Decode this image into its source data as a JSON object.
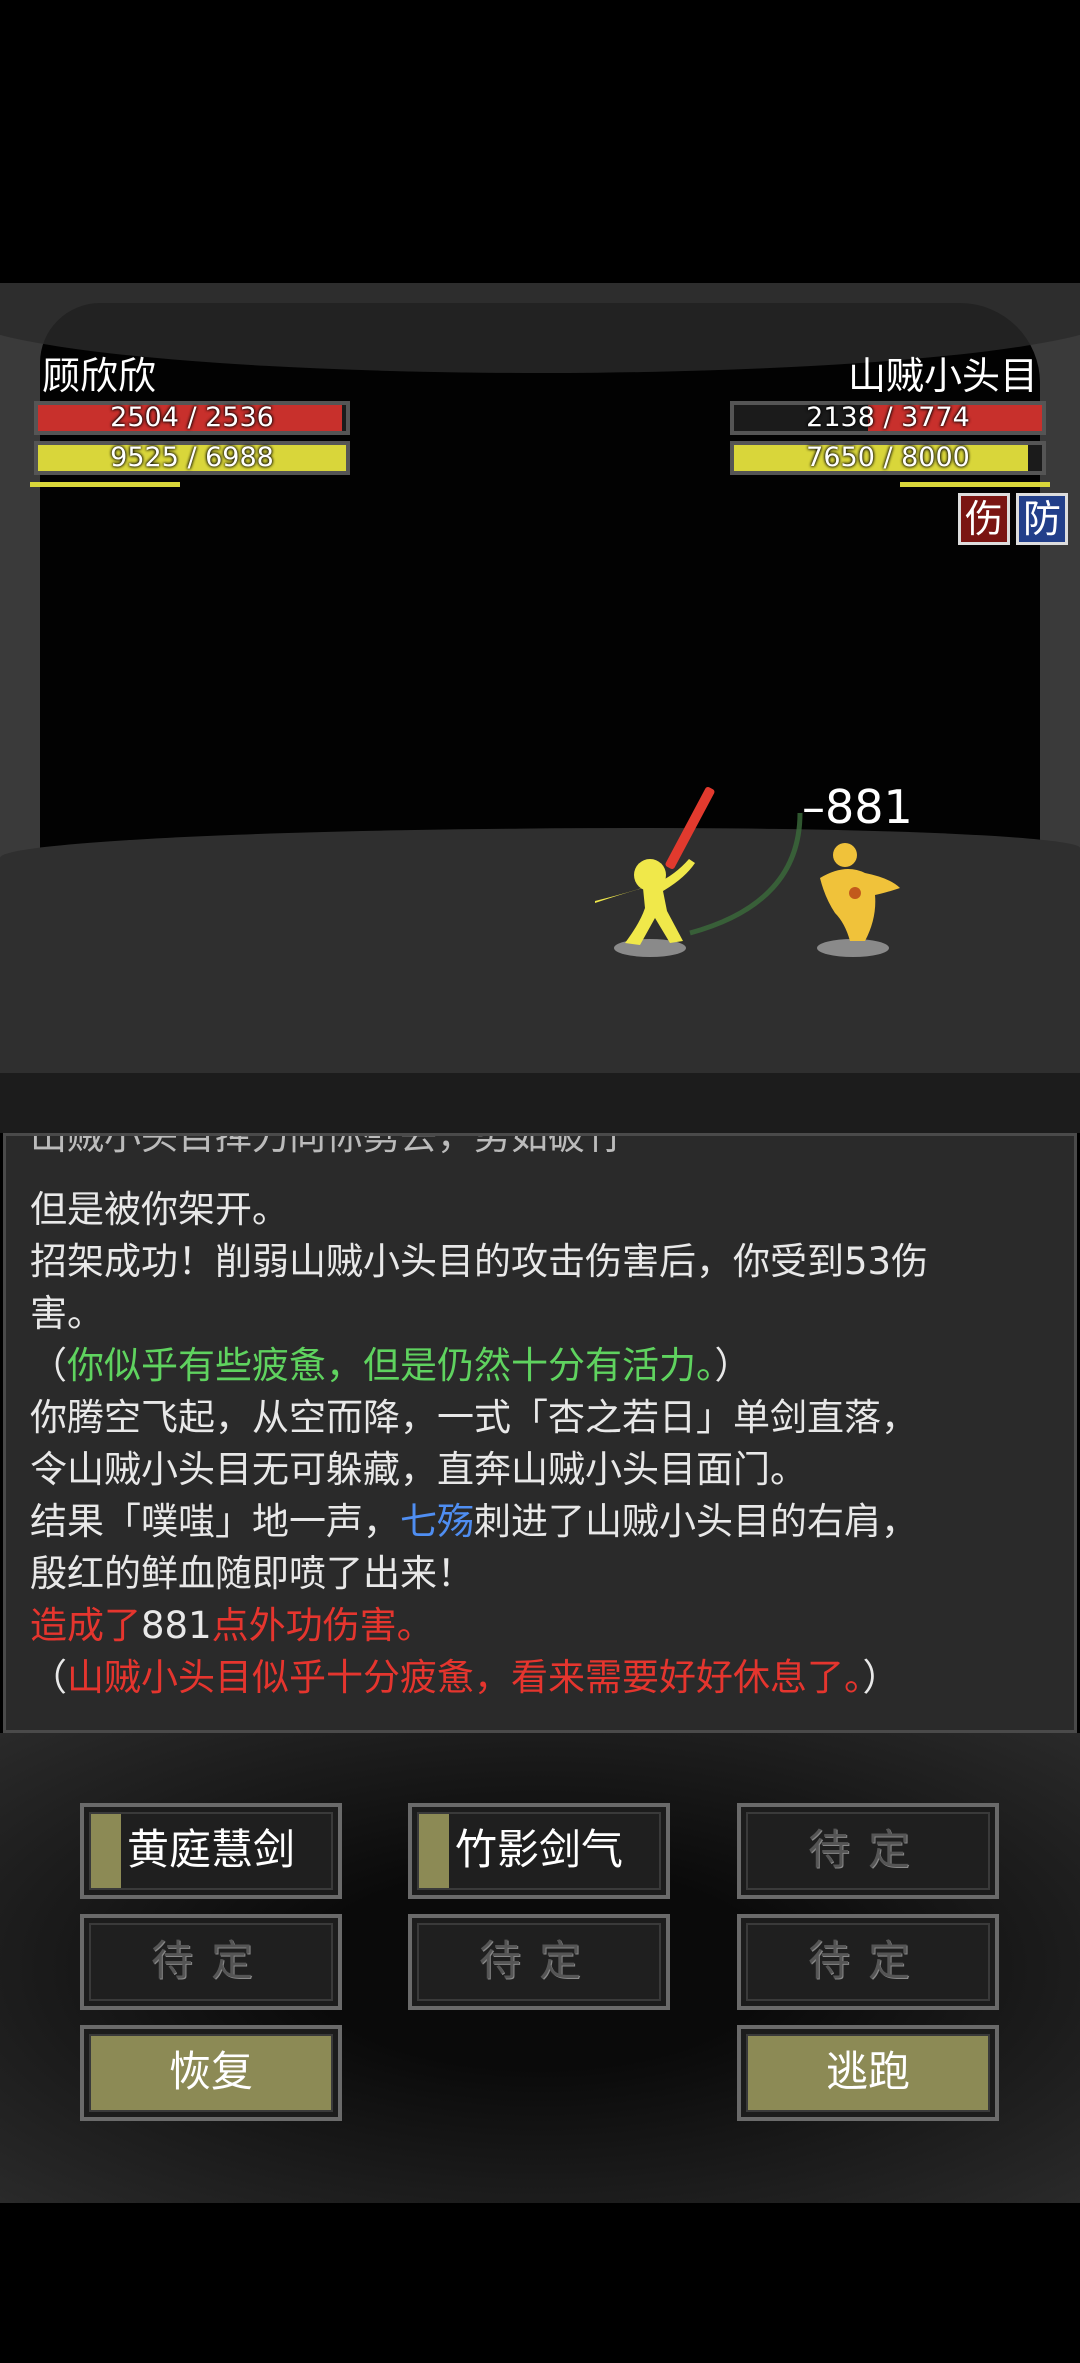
{
  "player": {
    "name": "顾欣欣",
    "hp_text": "2504 / 2536",
    "hp_fraction": 0.987,
    "mp_text": "9525 / 6988",
    "mp_fraction": 1.0
  },
  "enemy": {
    "name": "山贼小头目",
    "hp_text": "2138 / 3774",
    "hp_fraction": 0.566,
    "mp_text": "7650 / 8000",
    "mp_fraction": 0.956,
    "status_badges": [
      "伤",
      "防"
    ]
  },
  "damage_popup": "–881",
  "log": {
    "cut_line": "山贼小头目挥刀向你劈去，势如破竹",
    "lines": [
      [
        {
          "t": "但是被你架开。",
          "c": "white"
        }
      ],
      [
        {
          "t": "招架成功！削弱山贼小头目的攻击伤害后，你受到53伤",
          "c": "white"
        }
      ],
      [
        {
          "t": "害。",
          "c": "white"
        }
      ],
      [
        {
          "t": "（",
          "c": "white"
        },
        {
          "t": "你似乎有些疲惫，但是仍然十分有活力。",
          "c": "green"
        },
        {
          "t": "）",
          "c": "white"
        }
      ],
      [
        {
          "t": "你腾空飞起，从空而降，一式「杏之若日」单剑直落，",
          "c": "white"
        }
      ],
      [
        {
          "t": "令山贼小头目无可躲藏，直奔山贼小头目面门。",
          "c": "white"
        }
      ],
      [
        {
          "t": "结果「噗嗤」地一声，",
          "c": "white"
        },
        {
          "t": "七殇",
          "c": "blue"
        },
        {
          "t": "刺进了山贼小头目的右肩，",
          "c": "white"
        }
      ],
      [
        {
          "t": "殷红的鲜血随即喷了出来！",
          "c": "white"
        }
      ],
      [
        {
          "t": "造成了",
          "c": "red"
        },
        {
          "t": "881",
          "c": "white"
        },
        {
          "t": "点外功伤害。",
          "c": "red"
        }
      ],
      [
        {
          "t": "（",
          "c": "white"
        },
        {
          "t": "山贼小头目似乎十分疲惫，看来需要好好休息了。",
          "c": "red"
        },
        {
          "t": "）",
          "c": "white"
        }
      ]
    ]
  },
  "skills": {
    "skill1": "黄庭慧剑",
    "skill2": "竹影剑气",
    "pending": "待定",
    "recover": "恢复",
    "flee": "逃跑"
  },
  "colors": {
    "hp": "#c8302c",
    "mp": "#d9d63a",
    "olive": "#8c8a55",
    "log_red": "#e5352e",
    "log_green": "#5fd35f",
    "log_blue": "#4f8ef2"
  }
}
